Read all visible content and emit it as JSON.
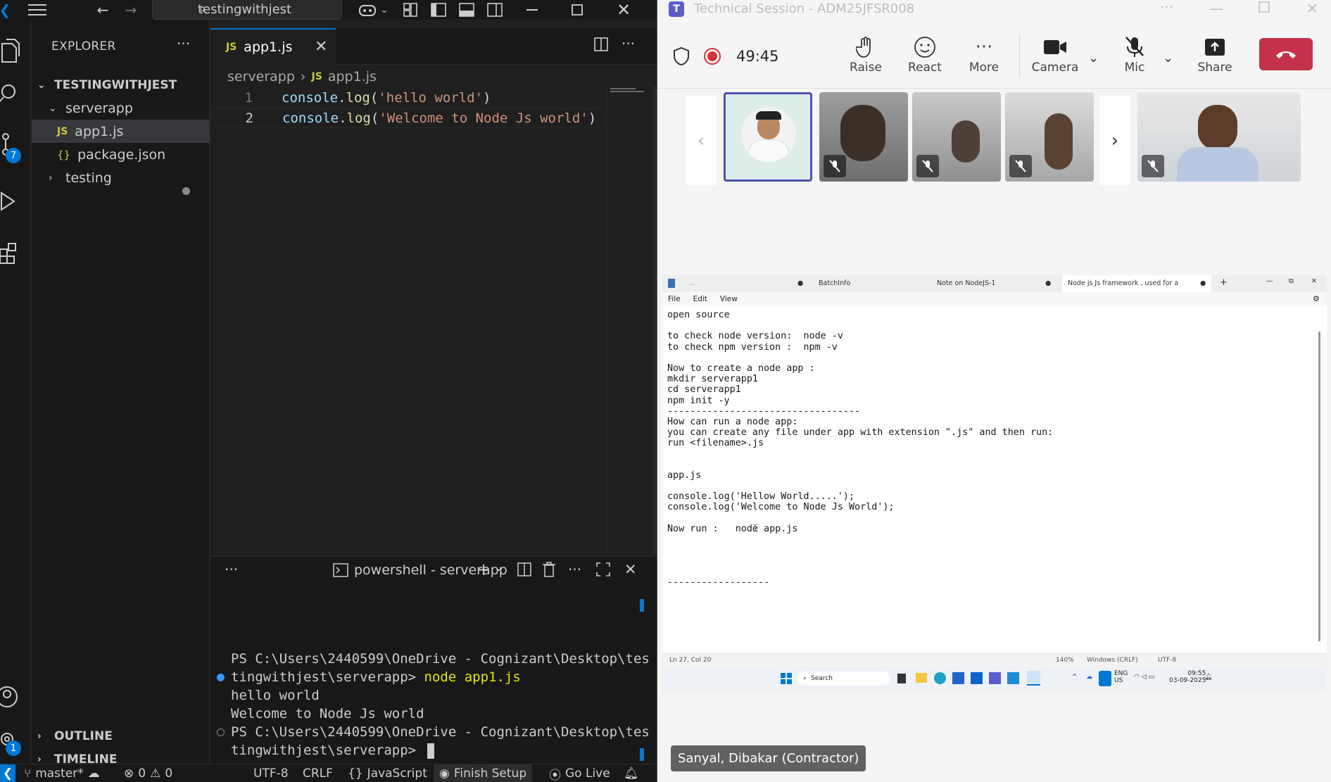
{
  "vscode": {
    "titlebar": {
      "search_text": "testingwithjest"
    },
    "activity_badges": {
      "scm": "7",
      "accounts": "1"
    },
    "explorer": {
      "header": "EXPLORER",
      "root": "TESTINGWITHJEST",
      "items": [
        {
          "label": "serverapp",
          "kind": "folder-open"
        },
        {
          "label": "app1.js",
          "kind": "js"
        },
        {
          "label": "package.json",
          "kind": "json"
        },
        {
          "label": "testing",
          "kind": "folder-closed"
        }
      ],
      "outline": "OUTLINE",
      "timeline": "TIMELINE"
    },
    "tab": {
      "label": "app1.js",
      "badge": "JS"
    },
    "breadcrumb": {
      "folder": "serverapp",
      "file_badge": "JS",
      "file": "app1.js"
    },
    "code": [
      {
        "n": "1",
        "obj": "console",
        "dot": ".",
        "fn": "log",
        "open": "(",
        "str": "'hello world'",
        "close": ")"
      },
      {
        "n": "2",
        "obj": "console",
        "dot": ".",
        "fn": "log",
        "open": "(",
        "str": "'Welcome to Node Js world'",
        "close": ")"
      }
    ],
    "terminal": {
      "tab_label": "powershell - serverapp",
      "lines": [
        "PS C:\\Users\\2440599\\OneDrive - Cognizant\\Desktop\\tes",
        "tingwithjest\\serverapp> ",
        "hello world",
        "Welcome to Node Js world",
        "PS C:\\Users\\2440599\\OneDrive - Cognizant\\Desktop\\tes",
        "tingwithjest\\serverapp> "
      ],
      "command": "node app1.js"
    },
    "status": {
      "branch": "master*",
      "errors": "0",
      "warnings": "0",
      "encoding": "UTF-8",
      "eol": "CRLF",
      "language": "JavaScript",
      "finish_setup": "Finish Setup",
      "go_live": "Go Live"
    }
  },
  "teams": {
    "title": "Technical Session - ADM25JFSR008",
    "timer": "49:45",
    "buttons": {
      "raise": "Raise",
      "react": "React",
      "more": "More",
      "camera": "Camera",
      "mic": "Mic",
      "share": "Share"
    },
    "presenter_name": "Sanyal, Dibakar (Contractor)",
    "colors": {
      "leave": "#c4314b",
      "record": "#d13438",
      "selected_tile": "#4f52b2"
    }
  },
  "shared_screen": {
    "tabs": [
      "...",
      "BatchInfo",
      "Note on NodeJS-1",
      "Node js  Js framework , used for a"
    ],
    "menu": [
      "File",
      "Edit",
      "View"
    ],
    "text_lines": [
      "open source",
      "",
      "to check node version:  node -v",
      "to check npm version :  npm -v",
      "",
      "Now to create a node app :",
      "mkdir serverapp1",
      "cd serverapp1",
      "npm init -y",
      "----------------------------------",
      "How can run a node app:",
      "you can create any file under app with extension \".js\" and then run:",
      "run <filename>.js",
      "",
      "",
      "app.js",
      "",
      "console.log('Hellow World.....');",
      "console.log('Welcome to Node Js World');",
      "",
      "Now run :   node app.js",
      "",
      "",
      "",
      "",
      "------------------"
    ],
    "status": {
      "position": "Ln 27, Col 20",
      "zoom": "140%",
      "eol": "Windows (CRLF)",
      "encoding": "UTF-8"
    },
    "taskbar": {
      "search": "Search",
      "lang": "ENG",
      "region": "US",
      "time": "09:55",
      "date": "03-09-2025"
    }
  }
}
